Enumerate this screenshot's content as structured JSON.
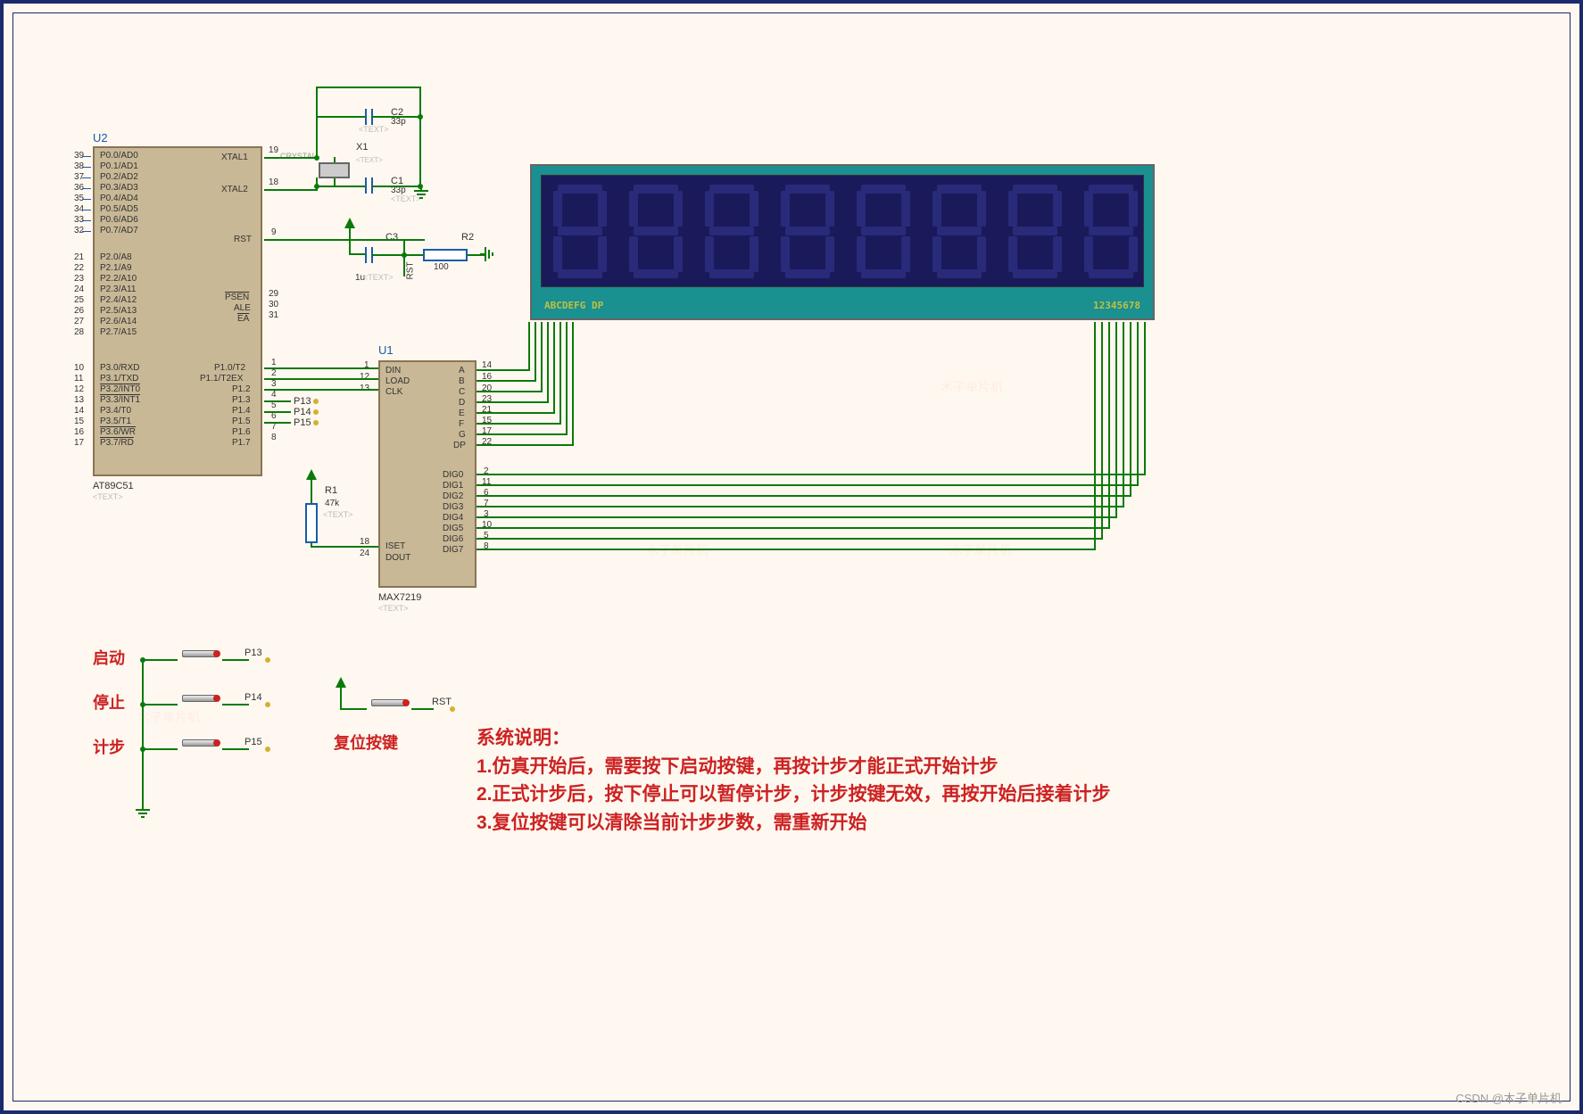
{
  "chip_u2": {
    "ref": "U2",
    "part": "AT89C51",
    "text_placeholder": "<TEXT>",
    "pins_left": [
      {
        "num": "39",
        "label": "P0.0/AD0"
      },
      {
        "num": "38",
        "label": "P0.1/AD1"
      },
      {
        "num": "37",
        "label": "P0.2/AD2"
      },
      {
        "num": "36",
        "label": "P0.3/AD3"
      },
      {
        "num": "35",
        "label": "P0.4/AD4"
      },
      {
        "num": "34",
        "label": "P0.5/AD5"
      },
      {
        "num": "33",
        "label": "P0.6/AD6"
      },
      {
        "num": "32",
        "label": "P0.7/AD7"
      },
      {
        "num": "21",
        "label": "P2.0/A8"
      },
      {
        "num": "22",
        "label": "P2.1/A9"
      },
      {
        "num": "23",
        "label": "P2.2/A10"
      },
      {
        "num": "24",
        "label": "P2.3/A11"
      },
      {
        "num": "25",
        "label": "P2.4/A12"
      },
      {
        "num": "26",
        "label": "P2.5/A13"
      },
      {
        "num": "27",
        "label": "P2.6/A14"
      },
      {
        "num": "28",
        "label": "P2.7/A15"
      },
      {
        "num": "10",
        "label": "P3.0/RXD"
      },
      {
        "num": "11",
        "label": "P3.1/TXD"
      },
      {
        "num": "12",
        "label": "P3.2/INT0"
      },
      {
        "num": "13",
        "label": "P3.3/INT1"
      },
      {
        "num": "14",
        "label": "P3.4/T0"
      },
      {
        "num": "15",
        "label": "P3.5/T1"
      },
      {
        "num": "16",
        "label": "P3.6/WR"
      },
      {
        "num": "17",
        "label": "P3.7/RD"
      }
    ],
    "pins_right": [
      {
        "num": "19",
        "label": "XTAL1"
      },
      {
        "num": "18",
        "label": "XTAL2"
      },
      {
        "num": "9",
        "label": "RST"
      },
      {
        "num": "29",
        "label": "PSEN"
      },
      {
        "num": "30",
        "label": "ALE"
      },
      {
        "num": "31",
        "label": "EA"
      },
      {
        "num": "1",
        "label": "P1.0/T2"
      },
      {
        "num": "2",
        "label": "P1.1/T2EX"
      },
      {
        "num": "3",
        "label": "P1.2"
      },
      {
        "num": "4",
        "label": "P1.3"
      },
      {
        "num": "5",
        "label": "P1.4"
      },
      {
        "num": "6",
        "label": "P1.5"
      },
      {
        "num": "7",
        "label": "P1.6"
      },
      {
        "num": "8",
        "label": "P1.7"
      }
    ]
  },
  "chip_u1": {
    "ref": "U1",
    "part": "MAX7219",
    "text_placeholder": "<TEXT>",
    "pins_left": [
      {
        "num": "1",
        "label": "DIN"
      },
      {
        "num": "12",
        "label": "LOAD"
      },
      {
        "num": "13",
        "label": "CLK"
      },
      {
        "num": "18",
        "label": "ISET"
      },
      {
        "num": "24",
        "label": "DOUT"
      }
    ],
    "pins_right": [
      {
        "num": "14",
        "label": "A"
      },
      {
        "num": "16",
        "label": "B"
      },
      {
        "num": "20",
        "label": "C"
      },
      {
        "num": "23",
        "label": "D"
      },
      {
        "num": "21",
        "label": "E"
      },
      {
        "num": "15",
        "label": "F"
      },
      {
        "num": "17",
        "label": "G"
      },
      {
        "num": "22",
        "label": "DP"
      },
      {
        "num": "2",
        "label": "DIG0"
      },
      {
        "num": "11",
        "label": "DIG1"
      },
      {
        "num": "6",
        "label": "DIG2"
      },
      {
        "num": "7",
        "label": "DIG3"
      },
      {
        "num": "3",
        "label": "DIG4"
      },
      {
        "num": "10",
        "label": "DIG5"
      },
      {
        "num": "5",
        "label": "DIG6"
      },
      {
        "num": "8",
        "label": "DIG7"
      }
    ]
  },
  "components": {
    "c1": {
      "ref": "C1",
      "value": "33p",
      "placeholder": "<TEXT>"
    },
    "c2": {
      "ref": "C2",
      "value": "33p",
      "placeholder": "<TEXT>"
    },
    "c3": {
      "ref": "C3",
      "value": "1u",
      "placeholder": "<TEXT>"
    },
    "x1": {
      "ref": "X1",
      "value": "CRYSTAL",
      "placeholder": "<TEXT>"
    },
    "r1": {
      "ref": "R1",
      "value": "47k",
      "placeholder": "<TEXT>"
    },
    "r2": {
      "ref": "R2",
      "value": "100"
    }
  },
  "display": {
    "left_label": "ABCDEFG DP",
    "right_label": "12345678"
  },
  "net_labels": {
    "p13": "P13",
    "p14": "P14",
    "p15": "P15",
    "rst": "RST"
  },
  "buttons": {
    "start": "启动",
    "stop": "停止",
    "step": "计步",
    "reset": "复位按键"
  },
  "instructions": {
    "title": "系统说明：",
    "line1": "1.仿真开始后，需要按下启动按键，再按计步才能正式开始计步",
    "line2": "2.正式计步后，按下停止可以暂停计步，计步按键无效，再按开始后接着计步",
    "line3": "3.复位按键可以清除当前计步步数，需重新开始"
  },
  "footer": "CSDN @木子单片机",
  "watermark_text": "木子单片机"
}
